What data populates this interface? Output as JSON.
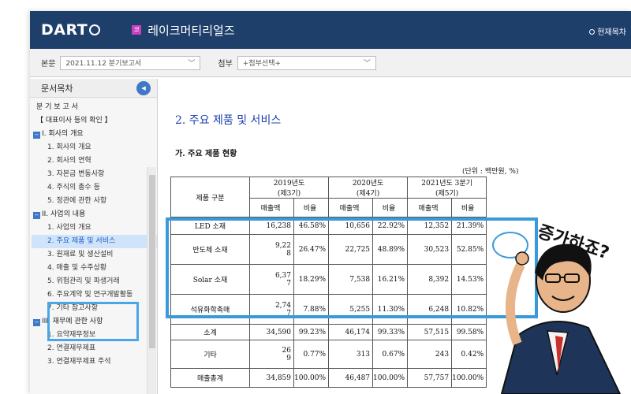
{
  "header": {
    "logo": "DART",
    "company_badge": "코",
    "company_name": "레이크머티리얼즈",
    "right_link": "현재목차"
  },
  "toolbar": {
    "main_label": "본문",
    "main_select": "2021.11.12  분기보고서",
    "attach_label": "첨부",
    "attach_select": "+첨부선택+"
  },
  "sidebar": {
    "title": "문서목차",
    "items": [
      {
        "label": "분 기 보 고 서",
        "level": 0
      },
      {
        "label": "【 대표이사 등의 확인 】",
        "level": 0
      },
      {
        "label": "I. 회사의 개요",
        "level": "sec"
      },
      {
        "label": "1. 회사의 개요",
        "level": 1
      },
      {
        "label": "2. 회사의 연혁",
        "level": 1
      },
      {
        "label": "3. 자본금 변동사항",
        "level": 1
      },
      {
        "label": "4. 주식의 총수 등",
        "level": 1
      },
      {
        "label": "5. 정관에 관한 사항",
        "level": 1
      },
      {
        "label": "II. 사업의 내용",
        "level": "sec"
      },
      {
        "label": "1. 사업의 개요",
        "level": 1
      },
      {
        "label": "2. 주요 제품 및 서비스",
        "level": 1,
        "selected": true
      },
      {
        "label": "3. 원재료 및 생산설비",
        "level": 1
      },
      {
        "label": "4. 매출 및 수주상황",
        "level": 1
      },
      {
        "label": "5. 위험관리 및 파생거래",
        "level": 1
      },
      {
        "label": "6. 주요계약 및 연구개발활동",
        "level": 1
      },
      {
        "label": "7. 기타 참고사항",
        "level": 1
      },
      {
        "label": "III. 재무에 관한 사항",
        "level": "sec"
      },
      {
        "label": "1. 요약재무정보",
        "level": 1
      },
      {
        "label": "2. 연결재무제표",
        "level": 1
      },
      {
        "label": "3. 연결재무제표 주석",
        "level": 1
      }
    ]
  },
  "content": {
    "title": "2. 주요 제품 및 서비스",
    "subtitle": "가. 주요 제품 현황",
    "unit": "(단위 : 백만원, %)",
    "table": {
      "col_product": "제품 구분",
      "periods": [
        {
          "year": "2019년도",
          "term": "(제3기)"
        },
        {
          "year": "2020년도",
          "term": "(제4기)"
        },
        {
          "year": "2021년도 3분기",
          "term": "(제5기)"
        }
      ],
      "sub_headers": [
        "매출액",
        "비율"
      ],
      "rows": [
        {
          "name": "LED 소재",
          "v": [
            "16,238",
            "46.58%",
            "10,656",
            "22.92%",
            "12,352",
            "21.39%"
          ]
        },
        {
          "name": "반도체 소재",
          "v": [
            "9,22\n8",
            "26.47%",
            "22,725",
            "48.89%",
            "30,523",
            "52.85%"
          ]
        },
        {
          "name": "Solar 소재",
          "v": [
            "6,37\n7",
            "18.29%",
            "7,538",
            "16.21%",
            "8,392",
            "14.53%"
          ]
        },
        {
          "name": "석유화학촉매",
          "v": [
            "2,74\n7",
            "7.88%",
            "5,255",
            "11.30%",
            "6,248",
            "10.82%"
          ]
        },
        {
          "name": "소계",
          "v": [
            "34,590",
            "99.23%",
            "46,174",
            "99.33%",
            "57,515",
            "99.58%"
          ]
        },
        {
          "name": "기타",
          "v": [
            "26\n9",
            "0.77%",
            "313",
            "0.67%",
            "243",
            "0.42%"
          ]
        },
        {
          "name": "매출총계",
          "v": [
            "34,859",
            "100.00%",
            "46,487",
            "100.00%",
            "57,757",
            "100.00%"
          ]
        }
      ]
    }
  },
  "annotation": {
    "text": "증가하죠?"
  },
  "colors": {
    "header_bg": "#1f3f6b",
    "highlight": "#3a9ad9",
    "title": "#1b3fae"
  }
}
